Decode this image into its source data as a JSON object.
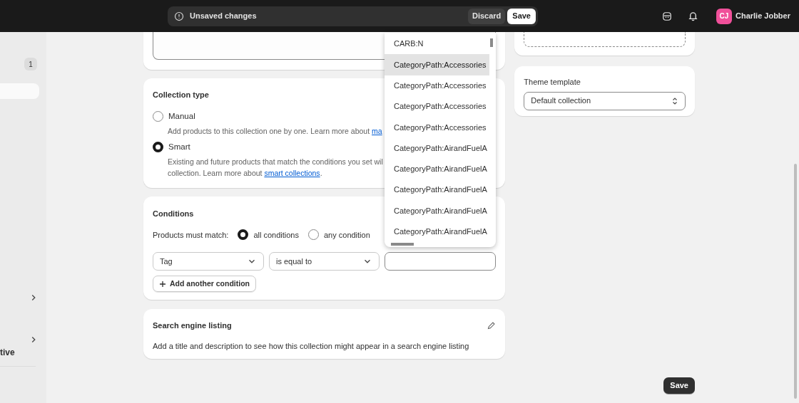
{
  "top_bar": {
    "unsaved_label": "Unsaved changes",
    "discard": "Discard",
    "save": "Save",
    "user": {
      "initials": "CJ",
      "name": "Charlie Jobber"
    }
  },
  "sidebar": {
    "badge": "1",
    "item_text": "tive"
  },
  "collection_type": {
    "title": "Collection type",
    "options": [
      {
        "label": "Manual",
        "selected": false,
        "description": "Add products to this collection one by one. Learn more about",
        "link": "ma"
      },
      {
        "label": "Smart",
        "selected": true,
        "description": "Existing and future products that match the conditions you set wil",
        "line2": "collection. Learn more about",
        "link": "smart collections",
        "after": "."
      }
    ]
  },
  "conditions": {
    "title": "Conditions",
    "match_label": "Products must match:",
    "match_options": [
      {
        "label": "all conditions",
        "selected": true
      },
      {
        "label": "any condition",
        "selected": false
      }
    ],
    "field": "Tag",
    "operator": "is equal to",
    "add_button": "Add another condition"
  },
  "search_listing": {
    "title": "Search engine listing",
    "description": "Add a title and description to see how this collection might appear in a search engine listing"
  },
  "theme_template": {
    "label": "Theme template",
    "value": "Default collection"
  },
  "dropdown": {
    "items": [
      {
        "label": "CARB:N",
        "selected": false
      },
      {
        "label": "CategoryPath:Accessories",
        "selected": true
      },
      {
        "label": "CategoryPath:Accessories",
        "selected": false
      },
      {
        "label": "CategoryPath:Accessories",
        "selected": false
      },
      {
        "label": "CategoryPath:Accessories",
        "selected": false
      },
      {
        "label": "CategoryPath:AirandFuelA",
        "selected": false
      },
      {
        "label": "CategoryPath:AirandFuelA",
        "selected": false
      },
      {
        "label": "CategoryPath:AirandFuelA",
        "selected": false
      },
      {
        "label": "CategoryPath:AirandFuelA",
        "selected": false
      },
      {
        "label": "CategoryPath:AirandFuelA",
        "selected": false
      }
    ]
  },
  "footer": {
    "save": "Save"
  }
}
